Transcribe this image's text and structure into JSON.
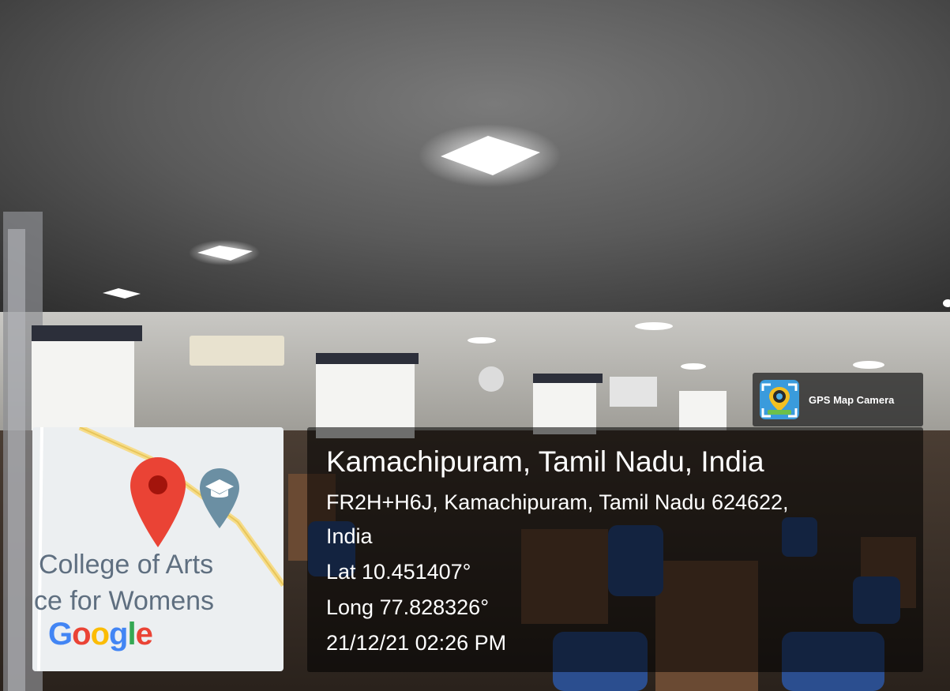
{
  "badge": {
    "label": "GPS Map Camera",
    "icon": "gps-camera-app-icon"
  },
  "info": {
    "title": "Kamachipuram, Tamil Nadu, India",
    "address_line_1": "FR2H+H6J, Kamachipuram, Tamil Nadu 624622,",
    "address_line_2": "India",
    "latitude": "Lat 10.451407°",
    "longitude": "Long 77.828326°",
    "datetime": "21/12/21 02:26 PM"
  },
  "map": {
    "label_line_1": "College of Arts",
    "label_line_2": "ce for Womens",
    "logo_letters": [
      "G",
      "o",
      "o",
      "g",
      "l",
      "e"
    ],
    "logo_colors": [
      "#4285F4",
      "#EA4335",
      "#FBBC05",
      "#4285F4",
      "#34A853",
      "#EA4335"
    ],
    "pin_color": "#EA4335",
    "school_marker_color": "#6b8fa3",
    "icons": [
      "location-pin-icon",
      "graduation-cap-icon"
    ]
  }
}
